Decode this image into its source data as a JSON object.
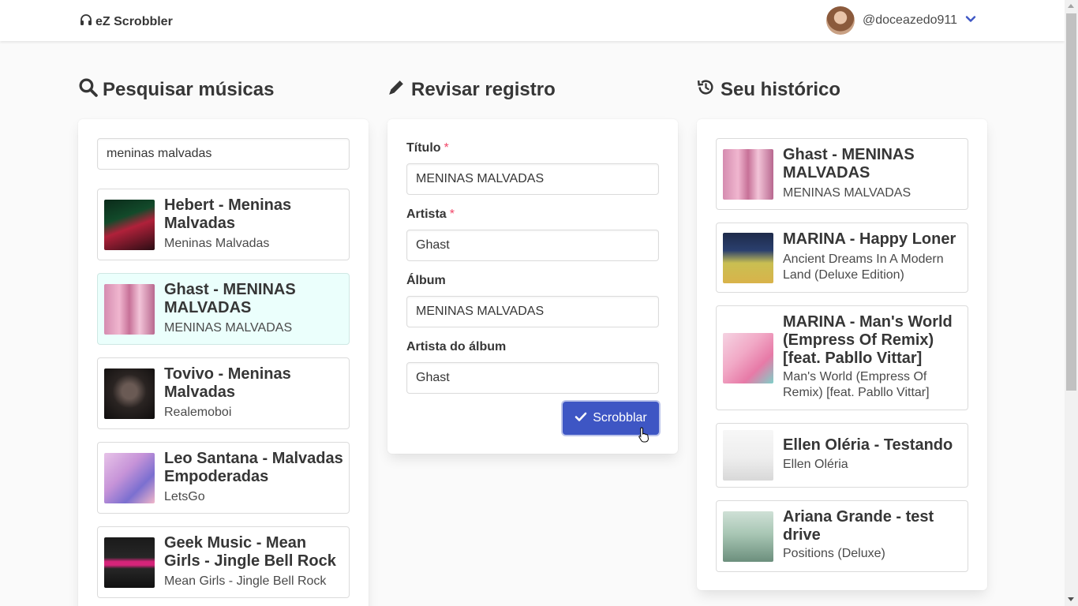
{
  "app": {
    "name": "eZ Scrobbler"
  },
  "user": {
    "username": "@doceazedo911"
  },
  "colors": {
    "accent": "#3e56c4",
    "selected_bg": "#ebfffc",
    "required": "#f14668"
  },
  "search": {
    "title": "Pesquisar músicas",
    "query": "meninas malvadas",
    "results": [
      {
        "title": "Hebert - Meninas Malvadas",
        "album": "Meninas Malvadas",
        "selected": false
      },
      {
        "title": "Ghast - MENINAS MALVADAS",
        "album": "MENINAS MALVADAS",
        "selected": true
      },
      {
        "title": "Tovivo - Meninas Malvadas",
        "album": "Realemoboi",
        "selected": false
      },
      {
        "title": "Leo Santana - Malvadas Empoderadas",
        "album": "LetsGo",
        "selected": false
      },
      {
        "title": "Geek Music - Mean Girls - Jingle Bell Rock",
        "album": "Mean Girls - Jingle Bell Rock",
        "selected": false
      }
    ]
  },
  "review": {
    "title": "Revisar registro",
    "fields": {
      "title": {
        "label": "Título",
        "required_mark": "*",
        "value": "MENINAS MALVADAS"
      },
      "artist": {
        "label": "Artista",
        "required_mark": "*",
        "value": "Ghast"
      },
      "album": {
        "label": "Álbum",
        "value": "MENINAS MALVADAS"
      },
      "album_artist": {
        "label": "Artista do álbum",
        "value": "Ghast"
      }
    },
    "submit_label": "Scrobblar"
  },
  "history": {
    "title": "Seu histórico",
    "items": [
      {
        "title": "Ghast - MENINAS MALVADAS",
        "album": "MENINAS MALVADAS"
      },
      {
        "title": "MARINA - Happy Loner",
        "album": "Ancient Dreams In A Modern Land (Deluxe Edition)"
      },
      {
        "title": "MARINA - Man's World (Empress Of Remix) [feat. Pabllo Vittar]",
        "album": "Man's World (Empress Of Remix) [feat. Pabllo Vittar]"
      },
      {
        "title": "Ellen Oléria - Testando",
        "album": "Ellen Oléria"
      },
      {
        "title": "Ariana Grande - test drive",
        "album": "Positions (Deluxe)"
      }
    ]
  },
  "icons": {
    "brand": "headphones-icon",
    "user_menu": "chevron-down-icon",
    "search_title": "search-icon",
    "review_title": "pencil-icon",
    "history_title": "history-icon",
    "submit": "check-icon"
  }
}
